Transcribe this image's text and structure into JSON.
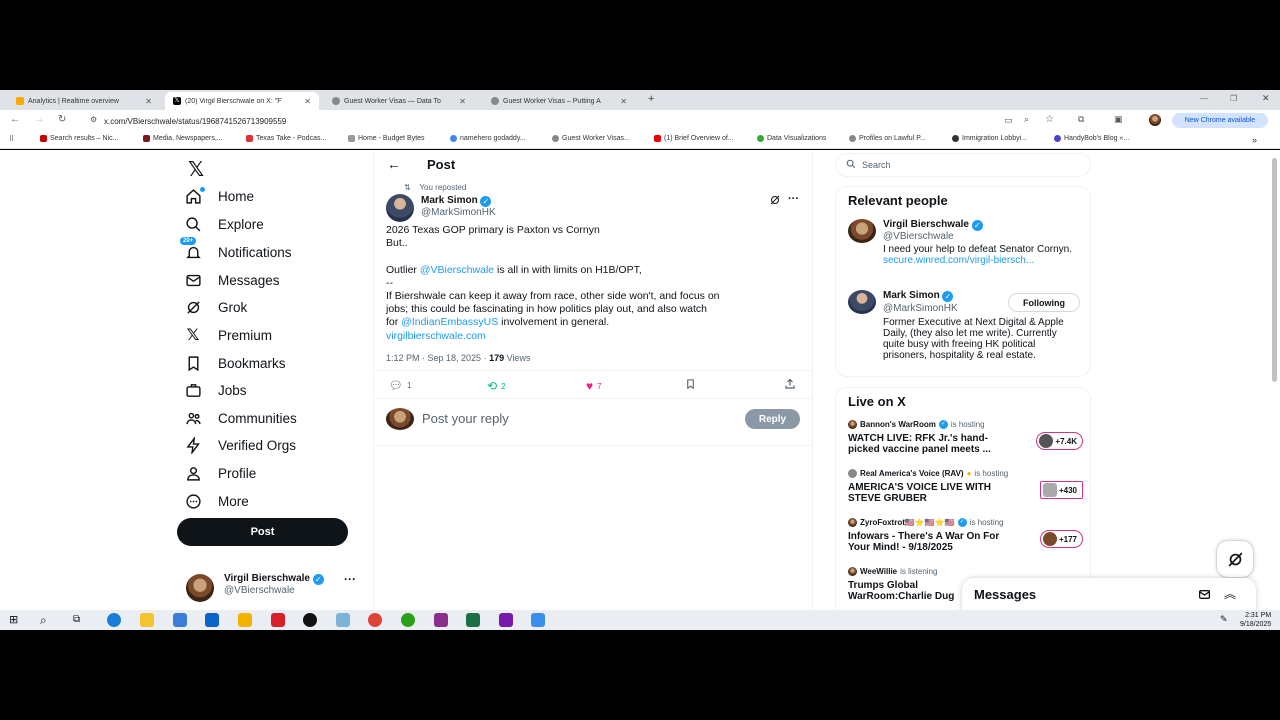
{
  "browser": {
    "tabs": [
      {
        "label": "Analytics | Realtime overview",
        "icon": "analytics-icon"
      },
      {
        "label": "(20) Virgil Bierschwale on X: \"F",
        "icon": "x-logo-icon"
      },
      {
        "label": "Guest Worker Visas — Data To",
        "icon": "globe-icon"
      },
      {
        "label": "Guest Worker Visas – Putting A",
        "icon": "globe-icon"
      }
    ],
    "url": "x.com/VBierschwale/status/1968741526713909559",
    "chrome_status": "New Chrome available",
    "bookmarks": [
      "Search results – Nic...",
      "Media, Newspapers,...",
      "Texas Take - Podcas...",
      "Home - Budget Bytes",
      "namehero godaddy...",
      "Guest Worker Visas...",
      "(1) Brief Overview of...",
      "Data Visualizations",
      "Profiles on Lawful P...",
      "Immigration Lobbyi...",
      "HandyBob's Blog «..."
    ]
  },
  "nav": {
    "items": [
      {
        "label": "Home",
        "icon": "home-icon"
      },
      {
        "label": "Explore",
        "icon": "search-icon"
      },
      {
        "label": "Notifications",
        "icon": "bell-icon",
        "badge": "20+"
      },
      {
        "label": "Messages",
        "icon": "mail-icon"
      },
      {
        "label": "Grok",
        "icon": "grok-icon"
      },
      {
        "label": "Premium",
        "icon": "x-logo-icon"
      },
      {
        "label": "Bookmarks",
        "icon": "bookmark-icon"
      },
      {
        "label": "Jobs",
        "icon": "briefcase-icon"
      },
      {
        "label": "Communities",
        "icon": "people-icon"
      },
      {
        "label": "Verified Orgs",
        "icon": "lightning-icon"
      },
      {
        "label": "Profile",
        "icon": "person-icon"
      },
      {
        "label": "More",
        "icon": "more-circle-icon"
      }
    ],
    "post_button": "Post",
    "account": {
      "name": "Virgil Bierschwale",
      "handle": "@VBierschwale"
    }
  },
  "post": {
    "header": "Post",
    "reposted": "You reposted",
    "author": {
      "name": "Mark Simon",
      "handle": "@MarkSimonHK"
    },
    "lines": {
      "l1": "2026 Texas GOP primary is Paxton vs Cornyn",
      "l2": "But..",
      "l3_pre": "Outlier ",
      "l3_mention": "@VBierschwale",
      "l3_post": " is all in with limits on H1B/OPT,",
      "l4": "--",
      "l5": "If Biershwale can keep it away from race, other side won't,  and focus on",
      "l6": "jobs; this could be fascinating in how politics play out, and also watch",
      "l7_pre": "for ",
      "l7_mention": "@IndianEmbassyUS",
      "l7_post": " involvement in general.",
      "l8_link": "virgilbierschwale.com"
    },
    "time": "1:12 PM · Sep 18, 2025 · ",
    "views_count": "179",
    "views_label": " Views",
    "stats": {
      "replies": "1",
      "reposts": "2",
      "likes": "7"
    },
    "reply_placeholder": "Post your reply",
    "reply_button": "Reply"
  },
  "sidebar": {
    "search_placeholder": "Search",
    "relevant_title": "Relevant people",
    "people": [
      {
        "name": "Virgil Bierschwale",
        "handle": "@VBierschwale",
        "bio_pre": "I need your help to defeat Senator Cornyn. ",
        "bio_link": "secure.winred.com/virgil-biersch..."
      },
      {
        "name": "Mark Simon",
        "handle": "@MarkSimonHK",
        "follow": "Following",
        "bio": "Former Executive at Next Digital & Apple Daily, (they also let me write). Currently quite busy with freeing HK political prisoners, hospitality & real estate."
      }
    ],
    "live_title": "Live on X",
    "live": [
      {
        "host": "Bannon's WarRoom",
        "status": "is hosting",
        "title": "WATCH LIVE: RFK Jr.'s hand-picked vaccine panel meets ...",
        "count": "+7.4K"
      },
      {
        "host": "Real America's Voice (RAV)",
        "status": "is hosting",
        "title": "AMERICA'S VOICE LIVE WITH STEVE GRUBER",
        "count": "+430"
      },
      {
        "host": "ZyroFoxtrot🇺🇸⭐🇺🇸⭐🇺🇸",
        "status": "is hosting",
        "title": "Infowars - There's A War On For Your Mind! - 9/18/2025",
        "count": "+177"
      },
      {
        "host": "WeeWillie",
        "status": "is listening",
        "title": "Trumps Global WarRoom:Charlie Dug",
        "count": ""
      }
    ],
    "messages_label": "Messages"
  },
  "taskbar": {
    "time": "2:31 PM",
    "date": "9/18/2025"
  }
}
